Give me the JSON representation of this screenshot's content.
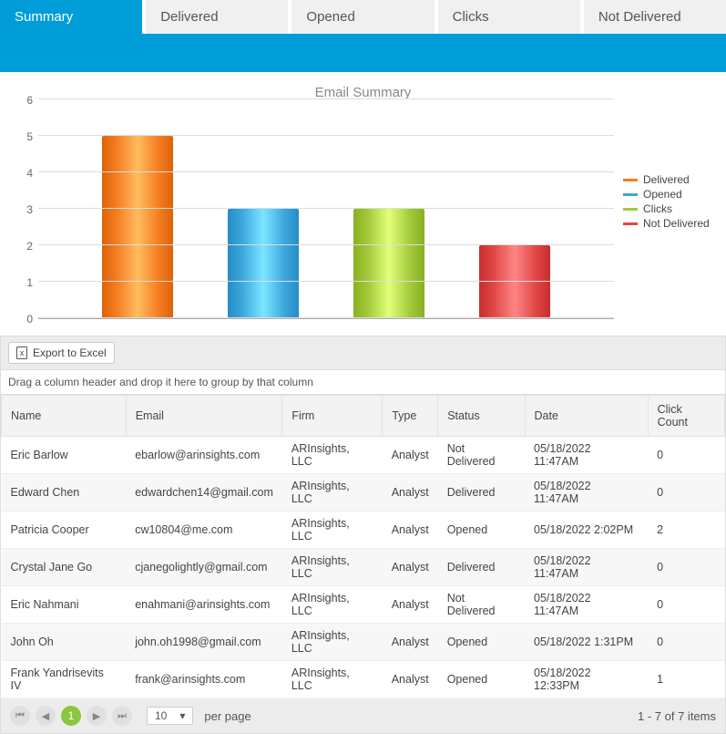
{
  "tabs": [
    {
      "label": "Summary",
      "active": true
    },
    {
      "label": "Delivered",
      "active": false
    },
    {
      "label": "Opened",
      "active": false
    },
    {
      "label": "Clicks",
      "active": false
    },
    {
      "label": "Not Delivered",
      "active": false
    }
  ],
  "chart_data": {
    "type": "bar",
    "title": "Email Summary",
    "categories": [
      "Delivered",
      "Opened",
      "Clicks",
      "Not Delivered"
    ],
    "values": [
      5,
      3,
      3,
      2
    ],
    "colors": [
      "#f57c20",
      "#3ca6dd",
      "#a2c93a",
      "#e04646"
    ],
    "ylim": [
      0,
      6
    ],
    "y_ticks": [
      0,
      1,
      2,
      3,
      4,
      5,
      6
    ],
    "xlabel": "",
    "ylabel": "",
    "legend_position": "right"
  },
  "toolbar": {
    "export_label": "Export to Excel"
  },
  "grid": {
    "group_hint": "Drag a column header and drop it here to group by that column",
    "columns": [
      "Name",
      "Email",
      "Firm",
      "Type",
      "Status",
      "Date",
      "Click Count"
    ],
    "rows": [
      {
        "name": "Eric Barlow",
        "email": "ebarlow@arinsights.com",
        "firm": "ARInsights, LLC",
        "type": "Analyst",
        "status": "Not Delivered",
        "date": "05/18/2022 11:47AM",
        "click_count": "0"
      },
      {
        "name": "Edward Chen",
        "email": "edwardchen14@gmail.com",
        "firm": "ARInsights, LLC",
        "type": "Analyst",
        "status": "Delivered",
        "date": "05/18/2022 11:47AM",
        "click_count": "0"
      },
      {
        "name": "Patricia Cooper",
        "email": "cw10804@me.com",
        "firm": "ARInsights, LLC",
        "type": "Analyst",
        "status": "Opened",
        "date": "05/18/2022 2:02PM",
        "click_count": "2"
      },
      {
        "name": "Crystal Jane Go",
        "email": "cjanegolightly@gmail.com",
        "firm": "ARInsights, LLC",
        "type": "Analyst",
        "status": "Delivered",
        "date": "05/18/2022 11:47AM",
        "click_count": "0"
      },
      {
        "name": "Eric Nahmani",
        "email": "enahmani@arinsights.com",
        "firm": "ARInsights, LLC",
        "type": "Analyst",
        "status": "Not Delivered",
        "date": "05/18/2022 11:47AM",
        "click_count": "0"
      },
      {
        "name": "John Oh",
        "email": "john.oh1998@gmail.com",
        "firm": "ARInsights, LLC",
        "type": "Analyst",
        "status": "Opened",
        "date": "05/18/2022 1:31PM",
        "click_count": "0"
      },
      {
        "name": "Frank Yandrisevits IV",
        "email": "frank@arinsights.com",
        "firm": "ARInsights, LLC",
        "type": "Analyst",
        "status": "Opened",
        "date": "05/18/2022 12:33PM",
        "click_count": "1"
      }
    ]
  },
  "pager": {
    "current_page": "1",
    "page_size": "10",
    "per_page_label": "per page",
    "summary": "1 - 7 of 7 items"
  }
}
